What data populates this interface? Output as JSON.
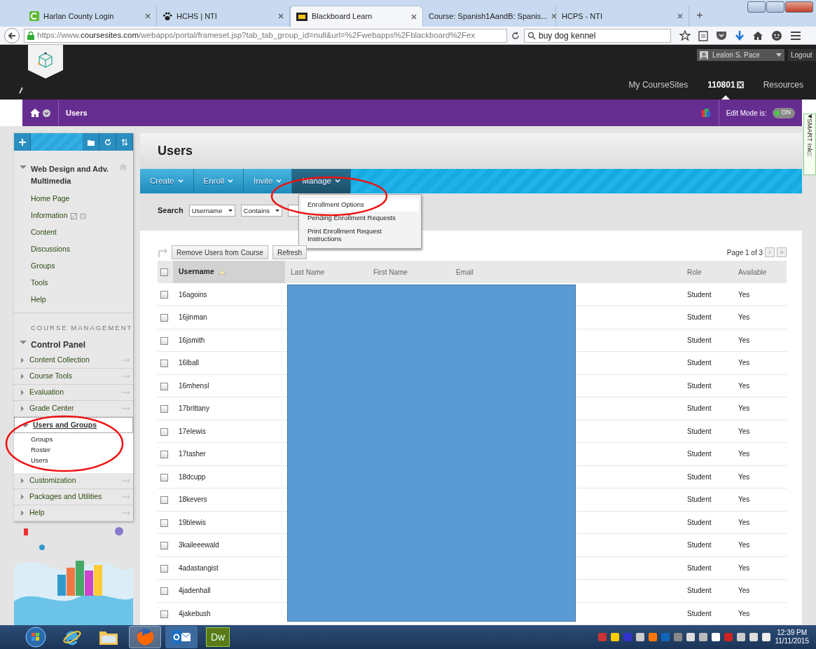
{
  "browser": {
    "tabs": [
      {
        "label": "Harlan County Login",
        "selected": false
      },
      {
        "label": "HCHS | NTI",
        "selected": false
      },
      {
        "label": "Blackboard Learn",
        "selected": true
      },
      {
        "label": "Course: Spanish1AandB: Spanis...",
        "selected": false
      },
      {
        "label": "HCPS - NTI",
        "selected": false
      }
    ],
    "new_tab": "+",
    "url": "https://www.**coursesites.com**/webapps/portal/frameset.jsp?tab_tab_group_id=null&url=%2Fwebapps%2Fblackboard%2Fex",
    "search_value": "buy dog kennel"
  },
  "header": {
    "user": "Lealon S. Pace",
    "logout": "Logout",
    "nav": [
      {
        "label": "My CourseSites",
        "selected": false
      },
      {
        "label": "110801",
        "selected": true
      },
      {
        "label": "Resources",
        "selected": false
      }
    ]
  },
  "breadcrumb": {
    "title": "Users",
    "edit_mode_label": "Edit Mode is:",
    "edit_mode": {
      "label": "ON",
      "on": true
    }
  },
  "sidebar": {
    "course": {
      "title": "Web Design and Adv. Multimedia",
      "expanded": true,
      "items": [
        "Home Page",
        "Information",
        "Content",
        "Discussions",
        "Groups",
        "Tools",
        "Help"
      ]
    },
    "section_heading": "COURSE MANAGEMENT",
    "control_panel": {
      "title": "Control Panel",
      "expanded": true,
      "items": [
        {
          "label": "Content Collection",
          "expanded": false
        },
        {
          "label": "Course Tools",
          "expanded": false
        },
        {
          "label": "Evaluation",
          "expanded": false
        },
        {
          "label": "Grade Center",
          "expanded": false
        },
        {
          "label": "Users and Groups",
          "expanded": true,
          "children": [
            {
              "label": "Groups"
            },
            {
              "label": "Roster"
            },
            {
              "label": "Users"
            }
          ]
        },
        {
          "label": "Customization",
          "expanded": false
        },
        {
          "label": "Packages and Utilities",
          "expanded": false
        },
        {
          "label": "Help",
          "expanded": false
        }
      ]
    }
  },
  "page": {
    "title": "Users",
    "actions": [
      {
        "label": "Create",
        "selected": false
      },
      {
        "label": "Enroll",
        "selected": false
      },
      {
        "label": "Invite",
        "selected": false
      },
      {
        "label": "Manage",
        "selected": true
      }
    ],
    "menu": [
      {
        "label": "Enrollment Options",
        "selected": true
      },
      {
        "label": "Pending Enrollment Requests",
        "selected": false
      },
      {
        "label": "Print Enrollment Request Instructions",
        "selected": false
      }
    ],
    "search": {
      "label": "Search",
      "field": "Username",
      "operator": "Contains"
    },
    "buttons": [
      "Remove Users from Course",
      "Refresh"
    ],
    "pagination": "Page 1 of 3",
    "pager_buttons": [
      {
        "label": "›",
        "disabled": true
      },
      {
        "label": "»",
        "disabled": true
      }
    ],
    "table": {
      "select_all_checked": false,
      "columns": [
        {
          "label": "Username",
          "sorted": true
        },
        {
          "label": "Last Name",
          "sorted": false
        },
        {
          "label": "First Name",
          "sorted": false
        },
        {
          "label": "Email",
          "sorted": false
        },
        {
          "label": "Role",
          "sorted": false
        },
        {
          "label": "Available",
          "sorted": false
        }
      ],
      "rows": [
        {
          "username": "16agoins",
          "role": "Student",
          "available": "Yes",
          "checked": false
        },
        {
          "username": "16jinman",
          "role": "Student",
          "available": "Yes",
          "checked": false
        },
        {
          "username": "16jsmith",
          "role": "Student",
          "available": "Yes",
          "checked": false
        },
        {
          "username": "16lball",
          "role": "Student",
          "available": "Yes",
          "checked": false
        },
        {
          "username": "16mhensl",
          "role": "Student",
          "available": "Yes",
          "checked": false
        },
        {
          "username": "17brittany",
          "role": "Student",
          "available": "Yes",
          "checked": false
        },
        {
          "username": "17elewis",
          "role": "Student",
          "available": "Yes",
          "checked": false
        },
        {
          "username": "17tasher",
          "role": "Student",
          "available": "Yes",
          "checked": false
        },
        {
          "username": "18dcupp",
          "role": "Student",
          "available": "Yes",
          "checked": false
        },
        {
          "username": "18kevers",
          "role": "Student",
          "available": "Yes",
          "checked": false
        },
        {
          "username": "19blewis",
          "role": "Student",
          "available": "Yes",
          "checked": false
        },
        {
          "username": "3kaileeewald",
          "role": "Student",
          "available": "Yes",
          "checked": false
        },
        {
          "username": "4adastangist",
          "role": "Student",
          "available": "Yes",
          "checked": false
        },
        {
          "username": "4jadenhall",
          "role": "Student",
          "available": "Yes",
          "checked": false
        },
        {
          "username": "4jakebush",
          "role": "Student",
          "available": "Yes",
          "checked": false
        }
      ]
    }
  },
  "smart_ink": "SMART Ink",
  "taskbar": {
    "apps": [
      {
        "kind": "start",
        "active": false
      },
      {
        "kind": "ie",
        "active": false
      },
      {
        "kind": "folder",
        "active": false
      },
      {
        "kind": "firefox",
        "active": true
      },
      {
        "kind": "outlook",
        "active": false
      },
      {
        "kind": "text",
        "label": "Dw",
        "active": false
      }
    ],
    "time": "12:39 PM",
    "date": "11/11/2015"
  }
}
